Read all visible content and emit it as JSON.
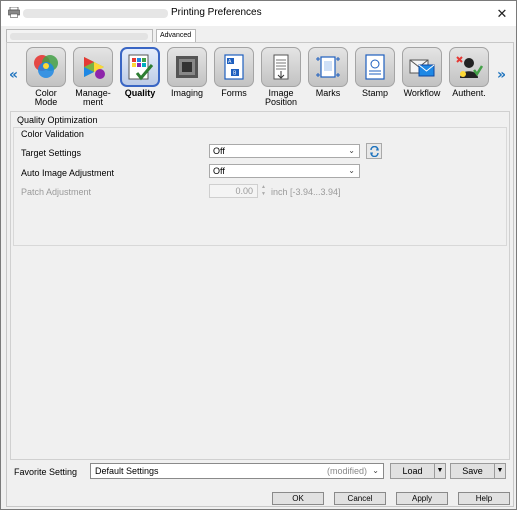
{
  "window": {
    "title": "Printing Preferences",
    "close_glyph": "✕"
  },
  "tabs": [
    {
      "label": "",
      "blurred": true
    },
    {
      "label": "Advanced",
      "selected": true
    }
  ],
  "toolbar": {
    "left_arrow": "«",
    "right_arrow": "»",
    "items": [
      {
        "label": "Color Mode",
        "icon": "color-mode-icon"
      },
      {
        "label": "Manage-\nment",
        "icon": "management-icon"
      },
      {
        "label": "Quality",
        "icon": "quality-icon",
        "selected": true
      },
      {
        "label": "Imaging",
        "icon": "imaging-icon"
      },
      {
        "label": "Forms",
        "icon": "forms-icon"
      },
      {
        "label": "Image\nPosition",
        "icon": "image-position-icon"
      },
      {
        "label": "Marks",
        "icon": "marks-icon"
      },
      {
        "label": "Stamp",
        "icon": "stamp-icon"
      },
      {
        "label": "Workflow",
        "icon": "workflow-icon"
      },
      {
        "label": "Authent.",
        "icon": "authentication-icon"
      }
    ]
  },
  "quality": {
    "group_title": "Quality Optimization",
    "subgroup_title": "Color Validation",
    "target_settings": {
      "label": "Target Settings",
      "value": "Off"
    },
    "auto_image_adjustment": {
      "label": "Auto Image Adjustment",
      "value": "Off"
    },
    "patch_adjustment": {
      "label": "Patch Adjustment",
      "value": "0.00",
      "unit": "inch [-3.94...3.94]",
      "disabled": true
    }
  },
  "favorite": {
    "label": "Favorite Setting",
    "value": "Default Settings",
    "modified": "(modified)",
    "load_label": "Load",
    "save_label": "Save"
  },
  "buttons": {
    "ok": "OK",
    "cancel": "Cancel",
    "apply": "Apply",
    "help": "Help"
  },
  "colors": {
    "accent": "#1e73be",
    "selected_border": "#3a66c4"
  }
}
